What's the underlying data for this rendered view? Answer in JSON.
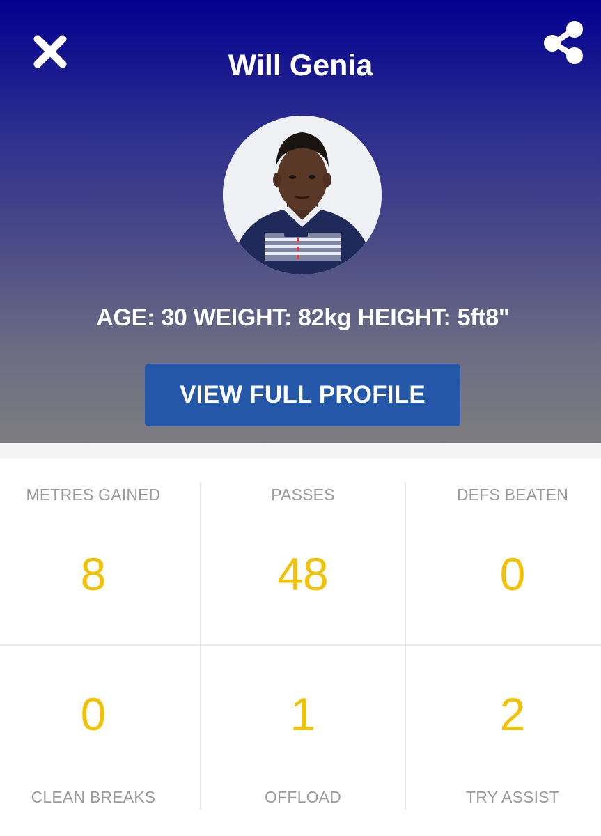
{
  "header": {
    "player_name": "Will Genia",
    "player_info": "AGE: 30 WEIGHT: 82kg HEIGHT: 5ft8\"",
    "profile_button_label": "VIEW FULL PROFILE",
    "close_icon": "close-icon",
    "share_icon": "share-icon"
  },
  "colors": {
    "header_top": "#03008f",
    "header_bottom": "#7d7d80",
    "button": "#2457a7",
    "stat_value": "#f2c200",
    "stat_label": "#9a9a9a"
  },
  "stats": {
    "top_row": [
      {
        "label": "METRES GAINED",
        "value": "8"
      },
      {
        "label": "PASSES",
        "value": "48"
      },
      {
        "label": "DEFS BEATEN",
        "value": "0"
      }
    ],
    "bottom_row": [
      {
        "label": "CLEAN BREAKS",
        "value": "0"
      },
      {
        "label": "OFFLOAD",
        "value": "1"
      },
      {
        "label": "TRY ASSIST",
        "value": "2"
      }
    ]
  }
}
